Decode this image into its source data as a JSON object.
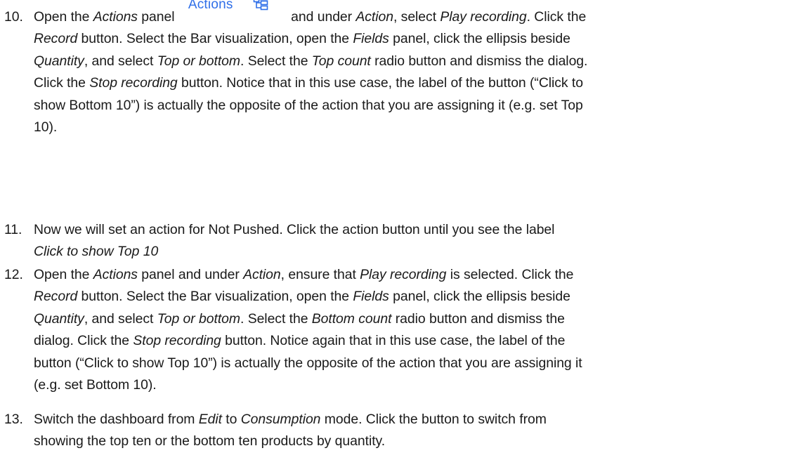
{
  "steps": [
    {
      "number": "10.",
      "icon_panel_label": "Actions",
      "icon_name": "actions-panel-icon",
      "lines": [
        [
          {
            "t": "Open the "
          },
          {
            "t": "Actions",
            "i": true
          },
          {
            "t": " panel "
          },
          {
            "icon": true
          },
          {
            "t": " and under "
          },
          {
            "t": "Action",
            "i": true
          },
          {
            "t": ", select "
          },
          {
            "t": "Play recording",
            "i": true
          },
          {
            "t": ". Click the"
          }
        ],
        [
          {
            "t": "Record",
            "i": true
          },
          {
            "t": " button. Select the Bar visualization, open the "
          },
          {
            "t": "Fields",
            "i": true
          },
          {
            "t": " panel, click the ellipsis beside"
          }
        ],
        [
          {
            "t": "Quantity",
            "i": true
          },
          {
            "t": ", and select "
          },
          {
            "t": "Top or bottom",
            "i": true
          },
          {
            "t": ". Select the "
          },
          {
            "t": "Top count",
            "i": true
          },
          {
            "t": " radio button and dismiss the dialog."
          }
        ],
        [
          {
            "t": "Click the "
          },
          {
            "t": "Stop recording",
            "i": true
          },
          {
            "t": " button. Notice that in this use case, the label of the button (“Click to"
          }
        ],
        [
          {
            "t": "show Bottom 10”) is actually the opposite of the action that you are assigning it (e.g. set Top"
          }
        ],
        [
          {
            "t": "10)."
          }
        ]
      ]
    },
    {
      "number": "11.",
      "lines": [
        [
          {
            "t": "Now we will set an action for Not Pushed. Click the action button until you see the label"
          }
        ],
        [
          {
            "t": "Click to show Top 10",
            "i": true
          }
        ]
      ]
    },
    {
      "number": "12.",
      "lines": [
        [
          {
            "t": "Open the "
          },
          {
            "t": "Actions",
            "i": true
          },
          {
            "t": " panel and under "
          },
          {
            "t": "Action",
            "i": true
          },
          {
            "t": ", ensure that "
          },
          {
            "t": "Play recording",
            "i": true
          },
          {
            "t": " is selected. Click the"
          }
        ],
        [
          {
            "t": "Record",
            "i": true
          },
          {
            "t": " button. Select the Bar visualization, open the "
          },
          {
            "t": "Fields",
            "i": true
          },
          {
            "t": " panel, click the ellipsis beside"
          }
        ],
        [
          {
            "t": "Quantity",
            "i": true
          },
          {
            "t": ", and select "
          },
          {
            "t": "Top or bottom",
            "i": true
          },
          {
            "t": ". Select the "
          },
          {
            "t": "Bottom count",
            "i": true
          },
          {
            "t": " radio button and dismiss the"
          }
        ],
        [
          {
            "t": "dialog. Click the "
          },
          {
            "t": "Stop recording",
            "i": true
          },
          {
            "t": " button. Notice again that in this use case, the label of the"
          }
        ],
        [
          {
            "t": "button (“Click to show Top 10”) is actually the opposite of the action that you are assigning it"
          }
        ],
        [
          {
            "t": "(e.g. set Bottom 10)."
          }
        ]
      ]
    },
    {
      "number": "13.",
      "lines": [
        [
          {
            "t": "Switch the dashboard from "
          },
          {
            "t": "Edit",
            "i": true
          },
          {
            "t": " to "
          },
          {
            "t": "Consumption",
            "i": true
          },
          {
            "t": " mode. Click the button to switch from"
          }
        ],
        [
          {
            "t": "showing the top ten or the bottom ten products by quantity."
          }
        ]
      ]
    }
  ],
  "colors": {
    "text": "#1a1a1a",
    "icon_accent": "#2f6fe8"
  }
}
